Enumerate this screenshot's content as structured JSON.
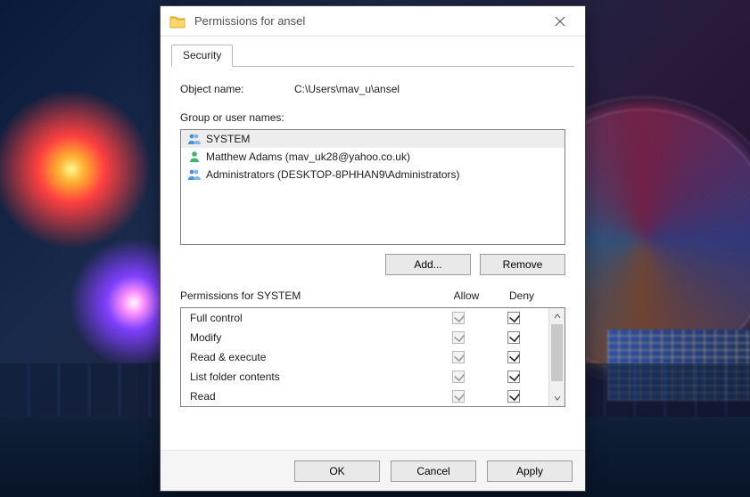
{
  "dialog": {
    "title": "Permissions for ansel",
    "tab_label": "Security",
    "object_name_label": "Object name:",
    "object_name": "C:\\Users\\mav_u\\ansel",
    "group_label": "Group or user names:",
    "users": [
      {
        "name": "SYSTEM",
        "type": "group",
        "selected": true
      },
      {
        "name": "Matthew Adams (mav_uk28@yahoo.co.uk)",
        "type": "user",
        "selected": false
      },
      {
        "name": "Administrators (DESKTOP-8PHHAN9\\Administrators)",
        "type": "group",
        "selected": false
      }
    ],
    "add_label": "Add...",
    "remove_label": "Remove",
    "permissions_label": "Permissions for SYSTEM",
    "allow_col": "Allow",
    "deny_col": "Deny",
    "permissions": [
      {
        "name": "Full control",
        "allow": true,
        "allow_enabled": false,
        "deny": true,
        "deny_enabled": true
      },
      {
        "name": "Modify",
        "allow": true,
        "allow_enabled": false,
        "deny": true,
        "deny_enabled": true
      },
      {
        "name": "Read & execute",
        "allow": true,
        "allow_enabled": false,
        "deny": true,
        "deny_enabled": true
      },
      {
        "name": "List folder contents",
        "allow": true,
        "allow_enabled": false,
        "deny": true,
        "deny_enabled": true
      },
      {
        "name": "Read",
        "allow": true,
        "allow_enabled": false,
        "deny": true,
        "deny_enabled": true
      }
    ],
    "ok_label": "OK",
    "cancel_label": "Cancel",
    "apply_label": "Apply"
  }
}
